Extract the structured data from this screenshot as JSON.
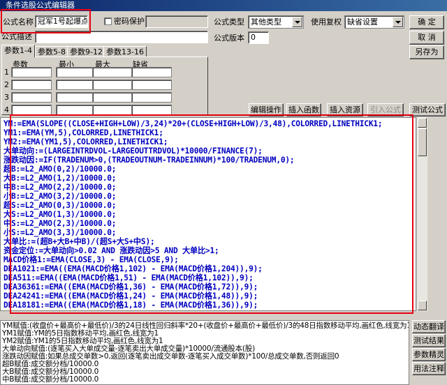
{
  "window": {
    "title": "条件选股公式编辑器"
  },
  "form": {
    "name_label": "公式名称",
    "name_value": "冠军1号起爆点",
    "password_label": "密码保护",
    "desc_label": "公式描述",
    "type_label": "公式类型",
    "type_value": "其他类型",
    "reweight_label": "使用复权",
    "reweight_value": "缺省设置",
    "version_label": "公式版本",
    "version_value": "0"
  },
  "buttons": {
    "ok": "确  定",
    "cancel": "取  消",
    "save_as": "另存为",
    "edit_ops": "编辑操作",
    "insert_func": "插入函数",
    "insert_res": "插入资源",
    "import_formula": "引入公式",
    "test_formula": "测试公式",
    "dynamic_translate": "动态翻译",
    "test_result": "测试结果",
    "param_wizard": "参数精灵",
    "usage_notes": "用法注释"
  },
  "tabs": [
    "参数1-4",
    "参数5-8",
    "参数9-12",
    "参数13-16"
  ],
  "param_headers": [
    "参数",
    "最小",
    "最大",
    "缺省"
  ],
  "param_rows": [
    "1",
    "2",
    "3",
    "4"
  ],
  "code_lines": [
    "YM:=EMA(SLOPE((CLOSE+HIGH+LOW)/3,24)*20+(CLOSE+HIGH+LOW)/3,48),COLORRED,LINETHICK1;",
    "YM1:=EMA(YM,5),COLORRED,LINETHICK1;",
    "YM2:=EMA(YM1,5),COLORRED,LINETHICK1;",
    "大单动向:=(LARGEINTRDVOL-LARGEOUTTRDVOL)*10000/FINANCE(7);",
    "涨跌动因:=IF(TRADENUM>0,(TRADEOUTNUM-TRADEINNUM)*100/TRADENUM,0);",
    "超B:=L2_AMO(0,2)/10000.0;",
    "大B:=L2_AMO(1,2)/10000.0;",
    "中B:=L2_AMO(2,2)/10000.0;",
    "小B:=L2_AMO(3,2)/10000.0;",
    "超S:=L2_AMO(0,3)/10000.0;",
    "大S:=L2_AMO(1,3)/10000.0;",
    "中S:=L2_AMO(2,3)/10000.0;",
    "小S:=L2_AMO(3,3)/10000.0;",
    "大单比:=(超B+大B+中B)/(超S+大S+中S);",
    "资金定位:=大单动向>0.02 AND 涨跌动因>5 AND 大单比>1;",
    "MACD价格1:=EMA(CLOSE,3) - EMA(CLOSE,9);",
    "DEA1021:=EMA((EMA(MACD价格1,102) - EMA(MACD价格1,204)),9);",
    "DEA511:=EMA((EMA(MACD价格1,51) - EMA(MACD价格1,102)),9);",
    "DEA36361:=EMA((EMA(MACD价格1,36) - EMA(MACD价格1,72)),9);",
    "DEA24241:=EMA((EMA(MACD价格1,24) - EMA(MACD价格1,48)),9);",
    "DEA18181:=EMA((EMA(MACD价格1,18) - EMA(MACD价格1,36)),9);"
  ],
  "desc_lines": [
    "YM赋值:(收盘价+最高价+最低价)/3的24日线性回归斜率*20+(收盘价+最高价+最低价)/3的48日指数移动平均,画红色,线宽为1",
    "YM1赋值:YM的5日指数移动平均,画红色,线宽为1",
    "YM2赋值:YM1的5日指数移动平均,画红色,线宽为1",
    "大单动向赋值:(逐笔买入大单成交量-逐笔卖出大单成交量)*10000/流通股本(股)",
    "涨跌动因赋值:如果总成交单数>0,返回(逐笔卖出成交单数-逐笔买入成交单数)*100/总成交单数,否则返回0",
    "超B赋值:成交额分档/10000.0",
    "大B赋值:成交额分档/10000.0",
    "中B赋值:成交额分档/10000.0"
  ],
  "colors": {
    "highlight_box": "#e60012",
    "code_text": "#0000c0",
    "titlebar": "#0a246a"
  }
}
